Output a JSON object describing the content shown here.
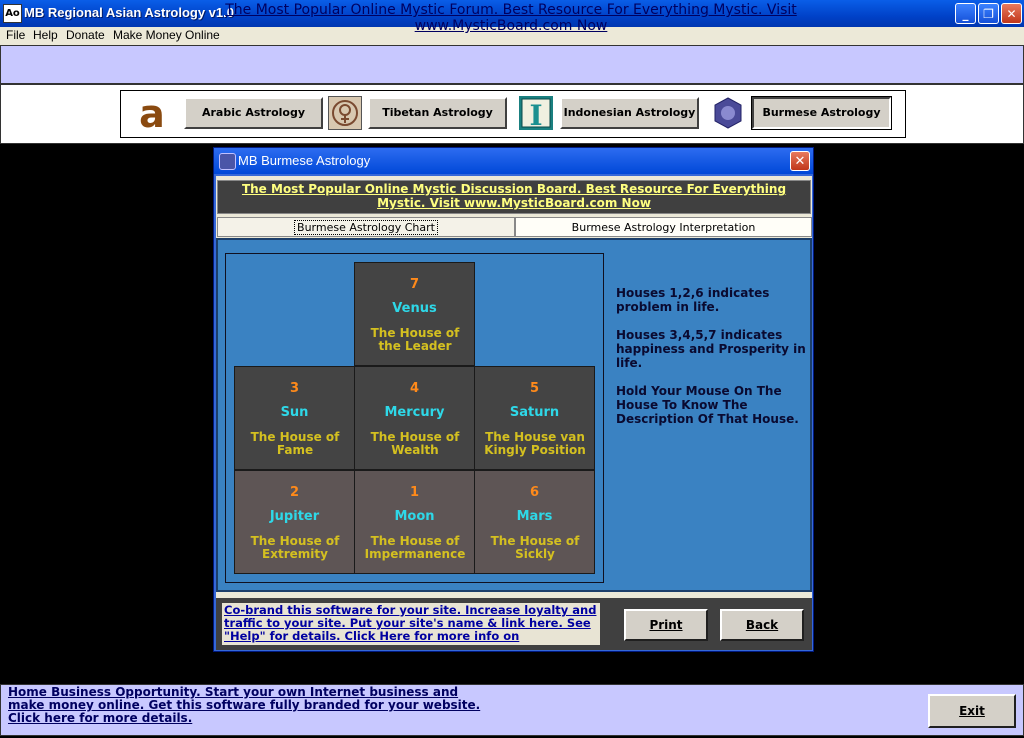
{
  "window": {
    "icon_text": "Ao",
    "title": "MB Regional Asian Astrology v1.0",
    "minimize_glyph": "_",
    "restore_glyph": "❐",
    "close_glyph": "✕"
  },
  "menu": [
    "File",
    "Help",
    "Donate",
    "Make Money Online"
  ],
  "top_banner": "The Most Popular Online Mystic Forum. Best Resource For Everything Mystic. Visit www.MysticBoard.com Now",
  "astrology_buttons": [
    {
      "label": "Arabic Astrology",
      "icon": "arabic-a-icon"
    },
    {
      "label": "Tibetan Astrology",
      "icon": "tibetan-symbol-icon"
    },
    {
      "label": "Indonesian Astrology",
      "icon": "indonesian-i-icon"
    },
    {
      "label": "Burmese Astrology",
      "icon": "burmese-emblem-icon"
    }
  ],
  "dialog": {
    "title": "MB Burmese Astrology",
    "close_glyph": "✕",
    "banner": "The Most Popular Online Mystic Discussion Board. Best Resource For Everything Mystic. Visit www.MysticBoard.com Now",
    "tabs": [
      "Burmese Astrology Chart",
      "Burmese Astrology Interpretation"
    ],
    "houses": {
      "h7": {
        "number": "7",
        "planet": "Venus",
        "house": "The House of the Leader"
      },
      "h3": {
        "number": "3",
        "planet": "Sun",
        "house": "The House of Fame"
      },
      "h4": {
        "number": "4",
        "planet": "Mercury",
        "house": "The House of Wealth"
      },
      "h5": {
        "number": "5",
        "planet": "Saturn",
        "house": "The House van Kingly Position"
      },
      "h2": {
        "number": "2",
        "planet": "Jupiter",
        "house": "The House of Extremity"
      },
      "h1": {
        "number": "1",
        "planet": "Moon",
        "house": "The House of Impermanence"
      },
      "h6": {
        "number": "6",
        "planet": "Mars",
        "house": "The House of Sickly"
      }
    },
    "info": [
      "Houses 1,2,6 indicates problem in life.",
      "Houses 3,4,5,7 indicates happiness and Prosperity in life.",
      "Hold Your Mouse On The House To Know The Description Of That House."
    ],
    "cobrand_text": "Co-brand this software for your site.  Increase loyalty and traffic to your site. Put your site's name &  link here. See \"Help\" for details.   Click Here for more info on",
    "print_label": "Print",
    "back_label": "Back"
  },
  "footer": {
    "text": "Home Business Opportunity. Start your own Internet business and make money online. Get this software fully branded for your website. Click here for more details.",
    "exit_label": "Exit"
  },
  "colors": {
    "title_bar": "#0048d8",
    "banner_bg": "#c8c8ff",
    "chart_panel": "#3a82c2",
    "house_number": "#ff8a1a",
    "planet_name": "#2ed8e8",
    "house_text": "#d4c020"
  }
}
